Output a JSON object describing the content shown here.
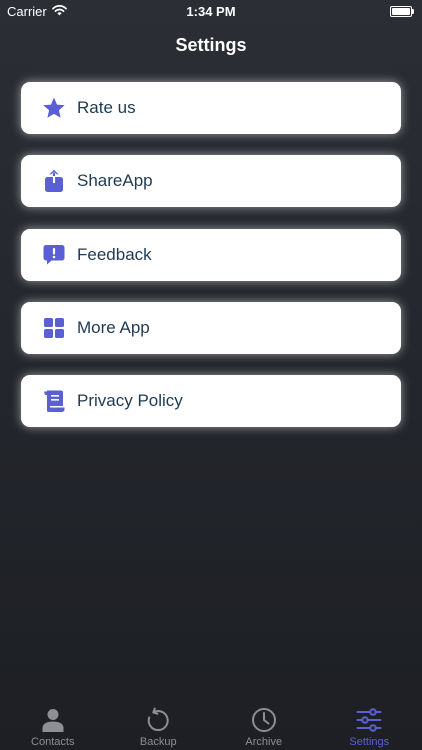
{
  "status_bar": {
    "carrier": "Carrier",
    "time": "1:34 PM",
    "icons": [
      "wifi-icon",
      "battery-icon"
    ]
  },
  "header": {
    "title": "Settings"
  },
  "settings": {
    "items": [
      {
        "label": "Rate us",
        "icon": "star-icon"
      },
      {
        "label": "ShareApp",
        "icon": "share-icon"
      },
      {
        "label": "Feedback",
        "icon": "feedback-icon"
      },
      {
        "label": "More App",
        "icon": "grid-icon"
      },
      {
        "label": "Privacy Policy",
        "icon": "document-icon"
      }
    ]
  },
  "tab_bar": {
    "tabs": [
      {
        "label": "Contacts",
        "icon": "person-icon",
        "active": false
      },
      {
        "label": "Backup",
        "icon": "backup-icon",
        "active": false
      },
      {
        "label": "Archive",
        "icon": "clock-icon",
        "active": false
      },
      {
        "label": "Settings",
        "icon": "sliders-icon",
        "active": true
      }
    ]
  },
  "colors": {
    "accent": "#5b5fd6",
    "item_text": "#1f3a52",
    "tab_inactive": "#8e8e93",
    "background": "#24272d"
  }
}
